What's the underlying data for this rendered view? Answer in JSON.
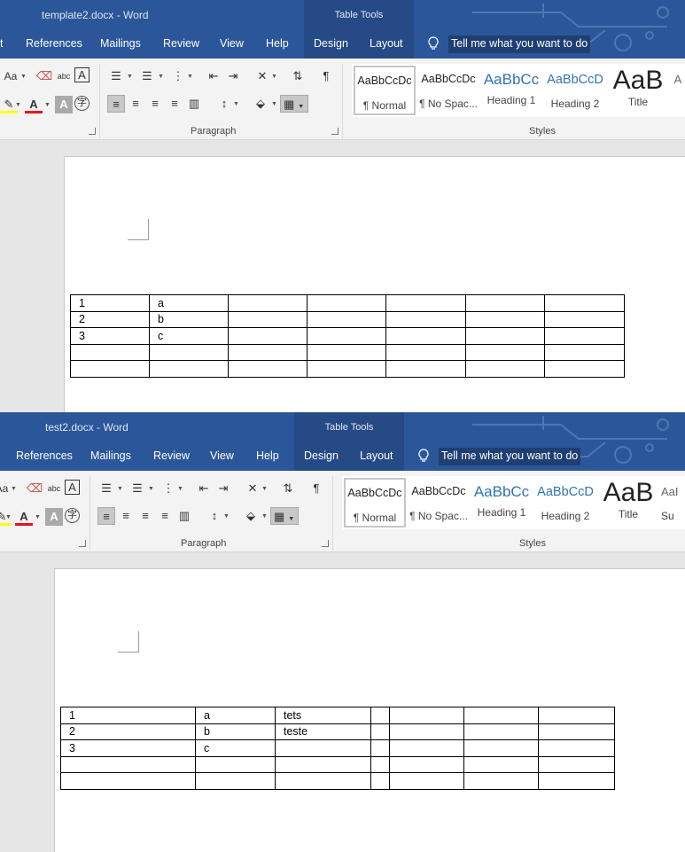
{
  "windows": [
    {
      "doc_title": "template2.docx  -  Word",
      "table_tools_label": "Table Tools",
      "tabs": [
        "t",
        "References",
        "Mailings",
        "Review",
        "View",
        "Help",
        "Design",
        "Layout"
      ],
      "tell_me": "Tell me what you want to do",
      "paragraph_group_label": "Paragraph",
      "styles_group_label": "Styles",
      "font_case_label": "Aa",
      "styles": [
        {
          "sample": "AaBbCcDc",
          "label": "¶ Normal"
        },
        {
          "sample": "AaBbCcDc",
          "label": "¶ No Spac..."
        },
        {
          "sample": "AaBbCc",
          "label": "Heading 1"
        },
        {
          "sample": "AaBbCcD",
          "label": "Heading 2"
        },
        {
          "sample": "AaB",
          "label": "Title"
        },
        {
          "sample": "A",
          "label": ""
        }
      ],
      "table": [
        [
          "1",
          "a",
          "",
          "",
          "",
          "",
          ""
        ],
        [
          "2",
          "b",
          "",
          "",
          "",
          "",
          ""
        ],
        [
          "3",
          "c",
          "",
          "",
          "",
          "",
          ""
        ],
        [
          "",
          "",
          "",
          "",
          "",
          "",
          ""
        ],
        [
          "",
          "",
          "",
          "",
          "",
          "",
          ""
        ]
      ]
    },
    {
      "doc_title": "test2.docx  -  Word",
      "table_tools_label": "Table Tools",
      "tabs": [
        "References",
        "Mailings",
        "Review",
        "View",
        "Help",
        "Design",
        "Layout"
      ],
      "tell_me": "Tell me what you want to do",
      "paragraph_group_label": "Paragraph",
      "styles_group_label": "Styles",
      "font_case_label": "Aa",
      "styles": [
        {
          "sample": "AaBbCcDc",
          "label": "¶ Normal"
        },
        {
          "sample": "AaBbCcDc",
          "label": "¶ No Spac..."
        },
        {
          "sample": "AaBbCc",
          "label": "Heading 1"
        },
        {
          "sample": "AaBbCcD",
          "label": "Heading 2"
        },
        {
          "sample": "AaB",
          "label": "Title"
        },
        {
          "sample": "AaI",
          "label": "Su"
        }
      ],
      "table": [
        [
          "1",
          "a",
          "tets",
          "",
          "",
          "",
          ""
        ],
        [
          "2",
          "b",
          "teste",
          "",
          "",
          "",
          ""
        ],
        [
          "3",
          "c",
          "",
          "",
          "",
          "",
          ""
        ],
        [
          "",
          "",
          "",
          "",
          "",
          "",
          ""
        ],
        [
          "",
          "",
          "",
          "",
          "",
          "",
          ""
        ]
      ]
    }
  ],
  "icons": {
    "bullets": "bullets-icon",
    "numbering": "numbering-icon",
    "multilevel": "multilevel-list-icon",
    "decrease_indent": "decrease-indent-icon",
    "increase_indent": "increase-indent-icon",
    "sort": "sort-icon",
    "pilcrow": "show-formatting-icon",
    "shading": "shading-icon",
    "borders": "borders-icon"
  },
  "colors": {
    "ribbon_blue": "#2b579a",
    "highlight_yellow": "#ffff00",
    "font_red": "#e81123"
  }
}
